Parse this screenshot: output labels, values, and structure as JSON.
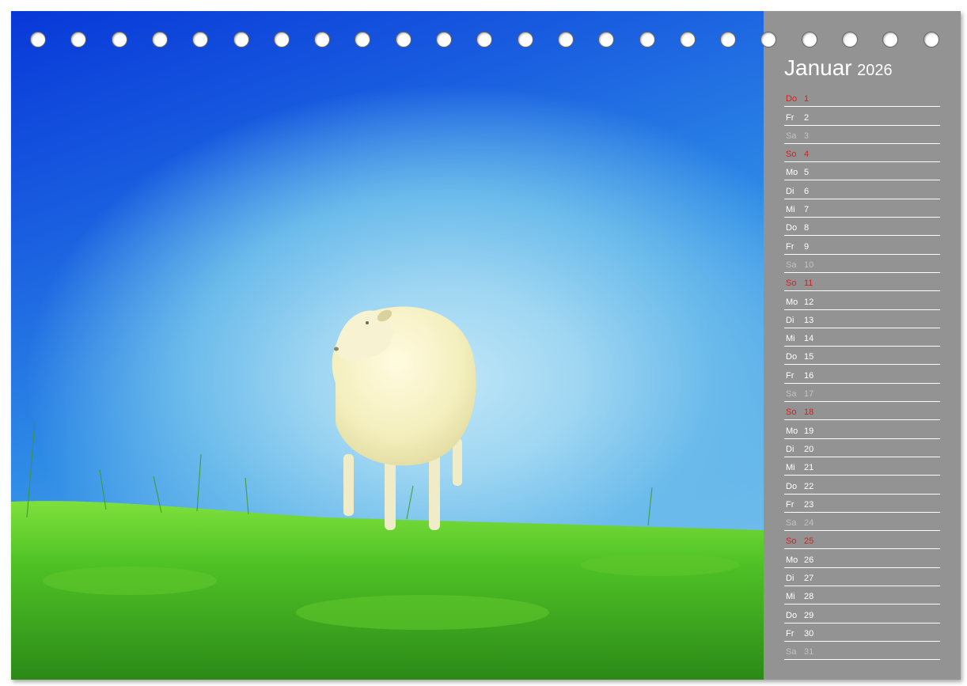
{
  "calendar": {
    "month": "Januar",
    "year": "2026",
    "days": [
      {
        "dn": "Do",
        "d": "1",
        "type": "sun"
      },
      {
        "dn": "Fr",
        "d": "2",
        "type": "work"
      },
      {
        "dn": "Sa",
        "d": "3",
        "type": "sat"
      },
      {
        "dn": "So",
        "d": "4",
        "type": "sun"
      },
      {
        "dn": "Mo",
        "d": "5",
        "type": "work"
      },
      {
        "dn": "Di",
        "d": "6",
        "type": "work"
      },
      {
        "dn": "Mi",
        "d": "7",
        "type": "work"
      },
      {
        "dn": "Do",
        "d": "8",
        "type": "work"
      },
      {
        "dn": "Fr",
        "d": "9",
        "type": "work"
      },
      {
        "dn": "Sa",
        "d": "10",
        "type": "sat"
      },
      {
        "dn": "So",
        "d": "11",
        "type": "sun"
      },
      {
        "dn": "Mo",
        "d": "12",
        "type": "work"
      },
      {
        "dn": "Di",
        "d": "13",
        "type": "work"
      },
      {
        "dn": "Mi",
        "d": "14",
        "type": "work"
      },
      {
        "dn": "Do",
        "d": "15",
        "type": "work"
      },
      {
        "dn": "Fr",
        "d": "16",
        "type": "work"
      },
      {
        "dn": "Sa",
        "d": "17",
        "type": "sat"
      },
      {
        "dn": "So",
        "d": "18",
        "type": "sun"
      },
      {
        "dn": "Mo",
        "d": "19",
        "type": "work"
      },
      {
        "dn": "Di",
        "d": "20",
        "type": "work"
      },
      {
        "dn": "Mi",
        "d": "21",
        "type": "work"
      },
      {
        "dn": "Do",
        "d": "22",
        "type": "work"
      },
      {
        "dn": "Fr",
        "d": "23",
        "type": "work"
      },
      {
        "dn": "Sa",
        "d": "24",
        "type": "sat"
      },
      {
        "dn": "So",
        "d": "25",
        "type": "sun"
      },
      {
        "dn": "Mo",
        "d": "26",
        "type": "work"
      },
      {
        "dn": "Di",
        "d": "27",
        "type": "work"
      },
      {
        "dn": "Mi",
        "d": "28",
        "type": "work"
      },
      {
        "dn": "Do",
        "d": "29",
        "type": "work"
      },
      {
        "dn": "Fr",
        "d": "30",
        "type": "work"
      },
      {
        "dn": "Sa",
        "d": "31",
        "type": "sat"
      }
    ]
  },
  "colors": {
    "sidebar": "#939393",
    "sunday": "#d61f1f",
    "saturday": "#c2c2c2",
    "weekday": "#ffffff"
  },
  "binding": {
    "hole_count": 23
  }
}
